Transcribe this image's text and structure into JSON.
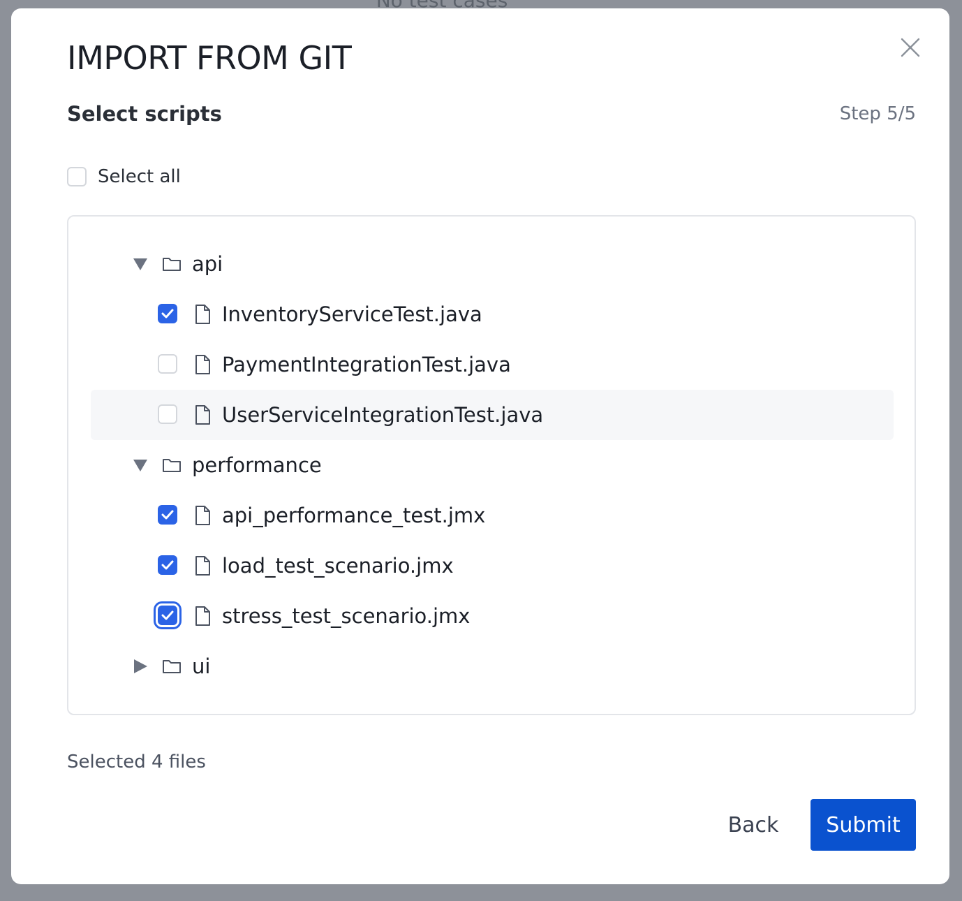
{
  "backdrop": {
    "text": "No test cases"
  },
  "modal": {
    "title": "IMPORT FROM GIT",
    "subtitle": "Select scripts",
    "step": "Step 5/5",
    "select_all_label": "Select all",
    "select_all_checked": false,
    "tree": [
      {
        "type": "folder",
        "name": "api",
        "expanded": true,
        "files": [
          {
            "name": "InventoryServiceTest.java",
            "checked": true
          },
          {
            "name": "PaymentIntegrationTest.java",
            "checked": false
          },
          {
            "name": "UserServiceIntegrationTest.java",
            "checked": false
          }
        ]
      },
      {
        "type": "folder",
        "name": "performance",
        "expanded": true,
        "files": [
          {
            "name": "api_performance_test.jmx",
            "checked": true
          },
          {
            "name": "load_test_scenario.jmx",
            "checked": true
          },
          {
            "name": "stress_test_scenario.jmx",
            "checked": true
          }
        ]
      },
      {
        "type": "folder",
        "name": "ui",
        "expanded": false,
        "files": []
      }
    ],
    "selected_count_text": "Selected 4 files",
    "back_label": "Back",
    "submit_label": "Submit"
  },
  "icons": {
    "close": "close-icon",
    "folder": "folder-icon",
    "file": "file-icon",
    "caret_expanded": "caret-down-icon",
    "caret_collapsed": "caret-right-icon",
    "check": "check-icon"
  },
  "colors": {
    "accent": "#2b63e6",
    "submit": "#0a52cf",
    "backdrop": "#8d9199"
  }
}
